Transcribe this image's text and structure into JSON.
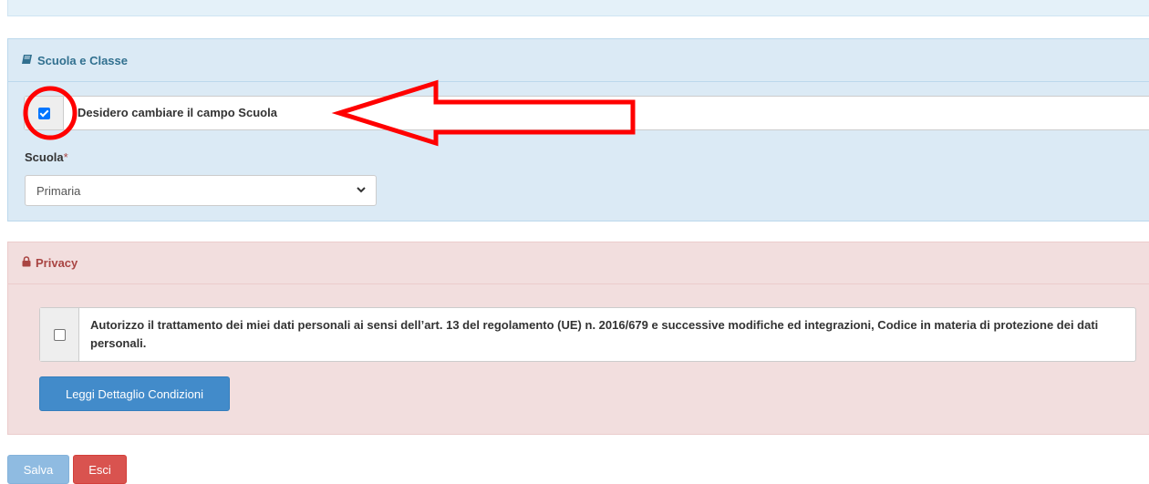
{
  "school_panel": {
    "title": "Scuola e Classe",
    "icon": "book-icon",
    "change_school_checkbox": {
      "label": "Desidero cambiare il campo Scuola",
      "checked": true
    },
    "school_field": {
      "label": "Scuola",
      "required_mark": "*",
      "selected": "Primaria"
    }
  },
  "privacy_panel": {
    "title": "Privacy",
    "icon": "lock-icon",
    "consent_checkbox": {
      "checked": false,
      "text": "Autorizzo il trattamento dei miei dati personali ai sensi dell’art. 13 del regolamento (UE) n. 2016/679 e successive modifiche ed integrazioni, Codice in materia di protezione dei dati personali."
    },
    "details_button": "Leggi Dettaglio Condizioni"
  },
  "actions": {
    "save": "Salva",
    "exit": "Esci"
  },
  "annotation": {
    "color": "#ff0000"
  }
}
